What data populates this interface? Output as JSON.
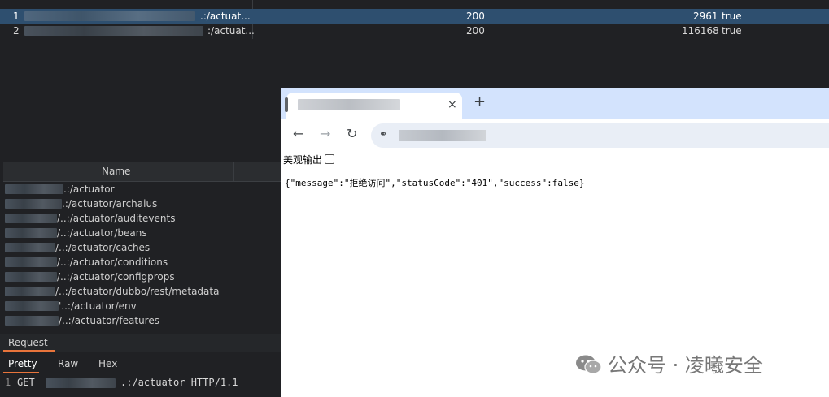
{
  "results": [
    {
      "num": "1",
      "path": ".:/actuat...",
      "status": "200",
      "length": "2961",
      "flag": "true",
      "selected": true
    },
    {
      "num": "2",
      "path": ":/actuat...",
      "status": "200",
      "length": "116168",
      "flag": "true",
      "selected": false
    }
  ],
  "sitemap": {
    "column_header": "Name",
    "rows": [
      ".:/actuator",
      ".:/actuator/archaius",
      "/..:/actuator/auditevents",
      "/..:/actuator/beans",
      "/..:/actuator/caches",
      "/..:/actuator/conditions",
      "/..:/actuator/configprops",
      "/..:/actuator/dubbo/rest/metadata",
      "'..:/actuator/env",
      "/..:/actuator/features"
    ]
  },
  "request_panel": {
    "title": "Request",
    "tabs": [
      "Pretty",
      "Raw",
      "Hex"
    ],
    "line_number": "1",
    "method": "GET",
    "rest": ".:/actuator HTTP/1.1"
  },
  "browser": {
    "close_glyph": "×",
    "new_tab_glyph": "+",
    "pretty_print_label": "美观输出",
    "json_body": "{\"message\":\"拒绝访问\",\"statusCode\":\"401\",\"success\":false}"
  },
  "watermark": {
    "text": "公众号 · 凌曦安全"
  },
  "colors": {
    "dark_bg": "#202124",
    "selected_row": "#2e4f6f",
    "accent_orange": "#e8743b",
    "chrome_tabstrip": "#d3e3fd"
  }
}
